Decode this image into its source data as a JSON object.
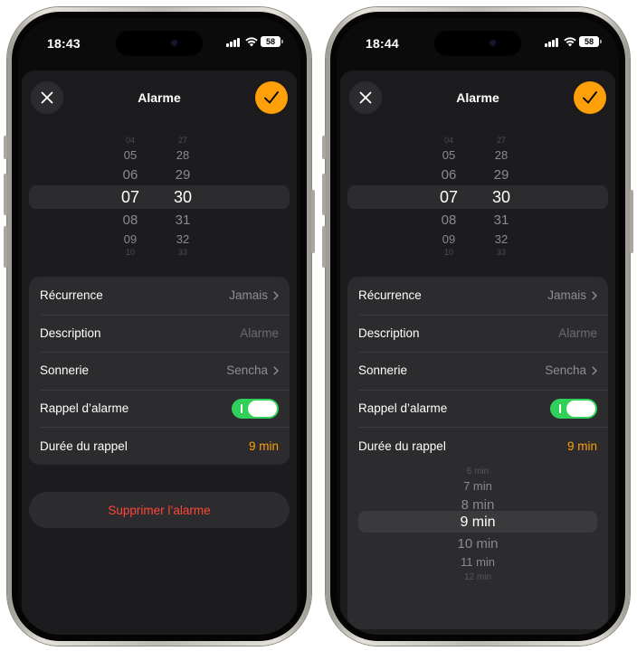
{
  "left": {
    "status": {
      "time": "18:43",
      "battery": "58"
    },
    "sheet": {
      "title": "Alarme"
    },
    "picker": {
      "hours": [
        "04",
        "05",
        "06",
        "07",
        "08",
        "09",
        "10"
      ],
      "minutes": [
        "27",
        "28",
        "29",
        "30",
        "31",
        "32",
        "33"
      ]
    },
    "rows": {
      "recurrence": {
        "label": "Récurrence",
        "value": "Jamais"
      },
      "description": {
        "label": "Description",
        "placeholder": "Alarme"
      },
      "ringtone": {
        "label": "Sonnerie",
        "value": "Sencha"
      },
      "snooze": {
        "label": "Rappel d’alarme",
        "enabled": true
      },
      "snooze_duration": {
        "label": "Durée du rappel",
        "value": "9 min"
      }
    },
    "delete_label": "Supprimer l’alarme"
  },
  "right": {
    "status": {
      "time": "18:44",
      "battery": "58"
    },
    "sheet": {
      "title": "Alarme"
    },
    "picker": {
      "hours": [
        "04",
        "05",
        "06",
        "07",
        "08",
        "09",
        "10"
      ],
      "minutes": [
        "27",
        "28",
        "29",
        "30",
        "31",
        "32",
        "33"
      ]
    },
    "rows": {
      "recurrence": {
        "label": "Récurrence",
        "value": "Jamais"
      },
      "description": {
        "label": "Description",
        "placeholder": "Alarme"
      },
      "ringtone": {
        "label": "Sonnerie",
        "value": "Sencha"
      },
      "snooze": {
        "label": "Rappel d’alarme",
        "enabled": true
      },
      "snooze_duration": {
        "label": "Durée du rappel",
        "value": "9 min"
      }
    },
    "duration_picker": [
      "6 min",
      "7 min",
      "8 min",
      "9 min",
      "10 min",
      "11 min",
      "12 min"
    ]
  },
  "colors": {
    "accent": "#ff9f0a",
    "toggle_on": "#30d158",
    "destructive": "#ff453a",
    "sheet_bg": "#1c1c1e",
    "cell_bg": "#2c2c2e"
  },
  "icons": {
    "close": "close-icon",
    "confirm": "checkmark-icon",
    "chevron": "chevron-right-icon",
    "signal": "cellular-signal-icon",
    "wifi": "wifi-icon",
    "battery": "battery-icon"
  }
}
